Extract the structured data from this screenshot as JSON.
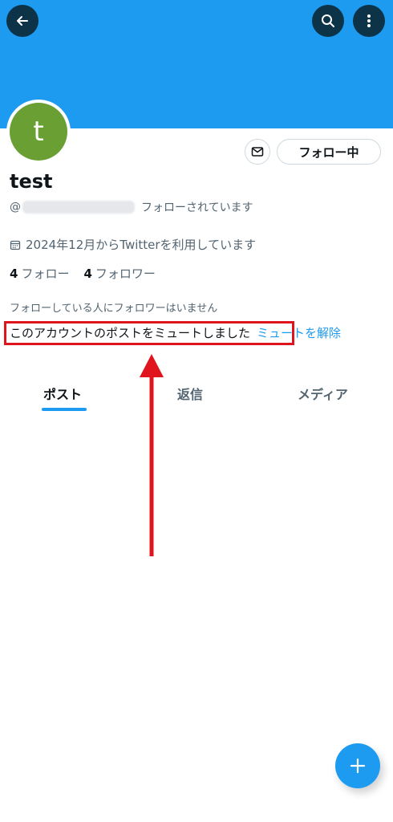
{
  "header": {
    "back_icon": "arrow-left-icon",
    "search_icon": "search-icon",
    "more_icon": "more-vertical-icon",
    "banner_color": "#1d9bf0"
  },
  "profile": {
    "avatar_letter": "t",
    "avatar_color": "#6aa033",
    "name": "test",
    "handle_prefix": "@",
    "follows_you": "フォローされています",
    "joined": "2024年12月からTwitterを利用しています",
    "following_count": "4",
    "following_label": "フォロー",
    "followers_count": "4",
    "followers_label": "フォロワー",
    "no_mutual_followers": "フォローしている人にフォロワーはいません",
    "muted_notice": "このアカウントのポストをミュートしました",
    "unmute_link": "ミュートを解除"
  },
  "actions": {
    "message_icon": "mail-icon",
    "follow_button": "フォロー中"
  },
  "tabs": [
    {
      "label": "ポスト",
      "active": true
    },
    {
      "label": "返信",
      "active": false
    },
    {
      "label": "メディア",
      "active": false
    }
  ],
  "annotation": {
    "highlight_color": "#e0141d"
  },
  "fab_icon": "plus-icon"
}
